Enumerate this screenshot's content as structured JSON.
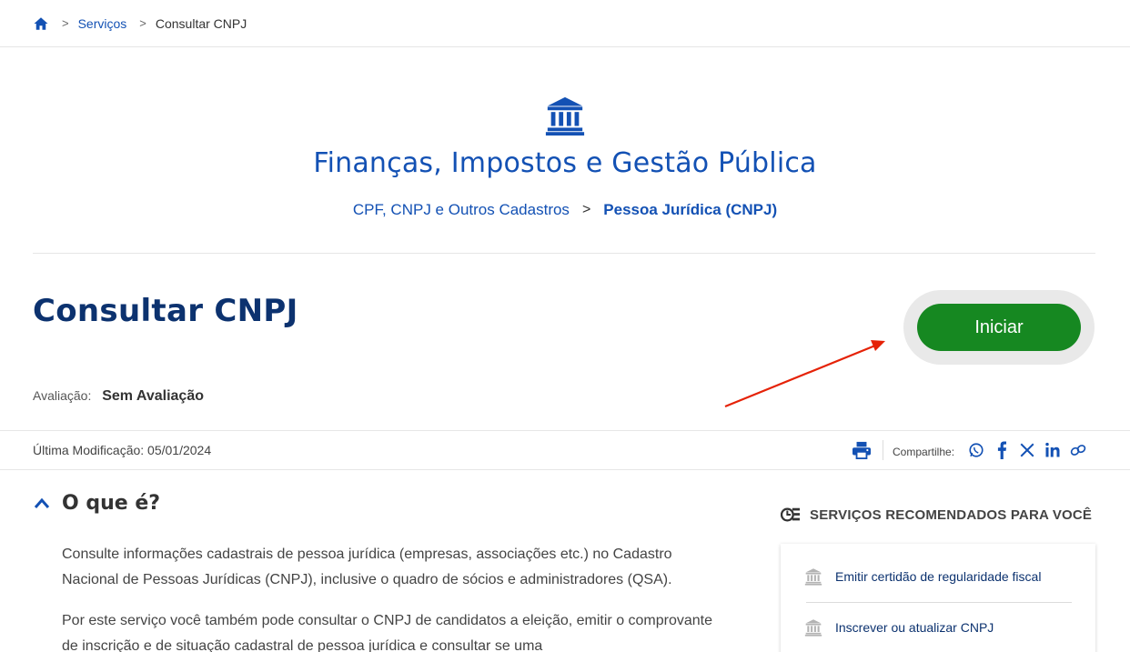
{
  "breadcrumb": {
    "home_icon": "home-icon",
    "items": [
      {
        "label": "Serviços"
      },
      {
        "label": "Consultar CNPJ"
      }
    ],
    "separator": ">"
  },
  "category": {
    "icon": "bank-building-icon",
    "title": "Finanças, Impostos e Gestão Pública",
    "sub_link": "CPF, CNPJ e Outros Cadastros",
    "sub_separator": ">",
    "sub_current": "Pessoa Jurídica (CNPJ)"
  },
  "service": {
    "title": "Consultar CNPJ",
    "start_label": "Iniciar",
    "rating_label": "Avaliação:",
    "rating_value": "Sem Avaliação"
  },
  "meta": {
    "last_modified": "Última Modificação: 05/01/2024",
    "share_label": "Compartilhe:",
    "share_icons": [
      "whatsapp-icon",
      "facebook-icon",
      "x-icon",
      "linkedin-icon",
      "link-icon"
    ]
  },
  "section": {
    "title": "O que é?",
    "paragraph_1": "Consulte informações cadastrais de pessoa jurídica (empresas, associações etc.) no Cadastro Nacional de Pessoas Jurídicas (CNPJ), inclusive o quadro de sócios e administradores (QSA).",
    "paragraph_2": "Por este serviço você também pode consultar o CNPJ de candidatos a eleição, emitir o comprovante de inscrição e de situação cadastral de pessoa jurídica e consultar se uma"
  },
  "recommended": {
    "title": "SERVIÇOS RECOMENDADOS PARA VOCÊ",
    "items": [
      {
        "label": "Emitir certidão de regularidade fiscal"
      },
      {
        "label": "Inscrever ou atualizar CNPJ"
      }
    ]
  },
  "colors": {
    "primary_blue": "#1351b4",
    "dark_blue": "#0c326f",
    "start_green": "#168821",
    "annotation_red": "#e52207"
  }
}
